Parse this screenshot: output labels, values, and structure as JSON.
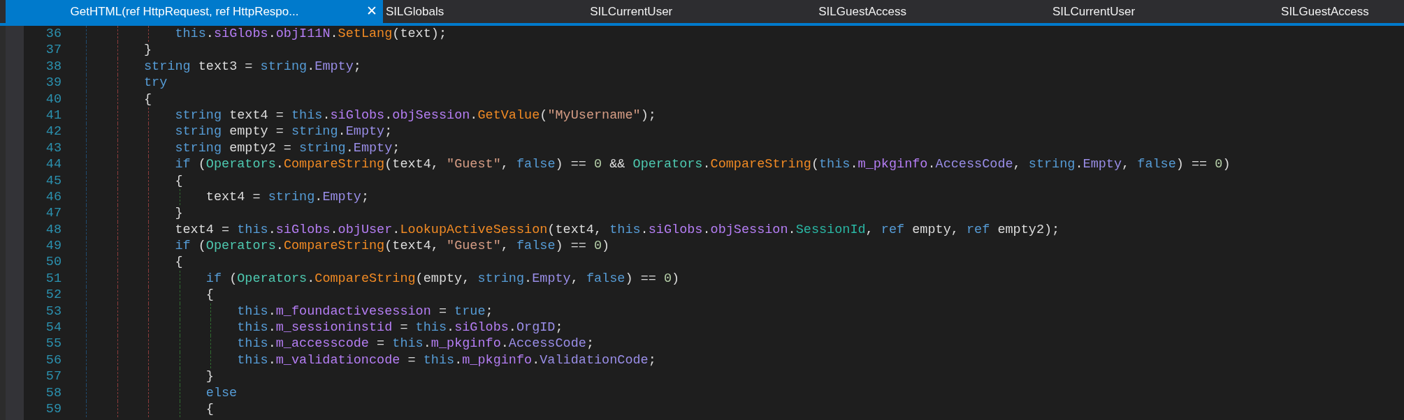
{
  "tabs": [
    {
      "label": "GetHTML(ref HttpRequest, ref HttpRespo...",
      "selected": true,
      "close": "✕"
    },
    {
      "label": "SILGlobals",
      "selected": false
    },
    {
      "label": "SILCurrentUser",
      "selected": false
    },
    {
      "label": "SILGuestAccess",
      "selected": false
    },
    {
      "label": "SILCurrentUser",
      "selected": false
    },
    {
      "label": "SILGuestAccess",
      "selected": false
    }
  ],
  "code": {
    "lines": [
      {
        "number": "36",
        "tokens": [
          {
            "kind": "keyword",
            "text": "    this"
          },
          {
            "kind": "plain",
            "text": "."
          },
          {
            "kind": "field",
            "text": "siGlobs"
          },
          {
            "kind": "plain",
            "text": "."
          },
          {
            "kind": "field",
            "text": "objI11N"
          },
          {
            "kind": "plain",
            "text": "."
          },
          {
            "kind": "method",
            "text": "SetLang"
          },
          {
            "kind": "plain",
            "text": "(text);"
          }
        ]
      },
      {
        "number": "37",
        "tokens": [
          {
            "kind": "plain",
            "text": "}"
          }
        ]
      },
      {
        "number": "38",
        "tokens": [
          {
            "kind": "keyword",
            "text": "string"
          },
          {
            "kind": "plain",
            "text": " text3 = "
          },
          {
            "kind": "keyword",
            "text": "string"
          },
          {
            "kind": "plain",
            "text": "."
          },
          {
            "kind": "member",
            "text": "Empty"
          },
          {
            "kind": "plain",
            "text": ";"
          }
        ]
      },
      {
        "number": "39",
        "tokens": [
          {
            "kind": "keyword",
            "text": "try"
          }
        ]
      },
      {
        "number": "40",
        "tokens": [
          {
            "kind": "plain",
            "text": "{"
          }
        ]
      },
      {
        "number": "41",
        "tokens": [
          {
            "kind": "keyword",
            "text": "    string"
          },
          {
            "kind": "plain",
            "text": " text4 = "
          },
          {
            "kind": "keyword",
            "text": "this"
          },
          {
            "kind": "plain",
            "text": "."
          },
          {
            "kind": "field",
            "text": "siGlobs"
          },
          {
            "kind": "plain",
            "text": "."
          },
          {
            "kind": "field",
            "text": "objSession"
          },
          {
            "kind": "plain",
            "text": "."
          },
          {
            "kind": "method",
            "text": "GetValue"
          },
          {
            "kind": "plain",
            "text": "("
          },
          {
            "kind": "string",
            "text": "\"MyUsername\""
          },
          {
            "kind": "plain",
            "text": ");"
          }
        ]
      },
      {
        "number": "42",
        "tokens": [
          {
            "kind": "keyword",
            "text": "    string"
          },
          {
            "kind": "plain",
            "text": " empty = "
          },
          {
            "kind": "keyword",
            "text": "string"
          },
          {
            "kind": "plain",
            "text": "."
          },
          {
            "kind": "member",
            "text": "Empty"
          },
          {
            "kind": "plain",
            "text": ";"
          }
        ]
      },
      {
        "number": "43",
        "tokens": [
          {
            "kind": "keyword",
            "text": "    string"
          },
          {
            "kind": "plain",
            "text": " empty2 = "
          },
          {
            "kind": "keyword",
            "text": "string"
          },
          {
            "kind": "plain",
            "text": "."
          },
          {
            "kind": "member",
            "text": "Empty"
          },
          {
            "kind": "plain",
            "text": ";"
          }
        ]
      },
      {
        "number": "44",
        "tokens": [
          {
            "kind": "keyword",
            "text": "    if"
          },
          {
            "kind": "plain",
            "text": " ("
          },
          {
            "kind": "type",
            "text": "Operators"
          },
          {
            "kind": "plain",
            "text": "."
          },
          {
            "kind": "method",
            "text": "CompareString"
          },
          {
            "kind": "plain",
            "text": "(text4, "
          },
          {
            "kind": "string",
            "text": "\"Guest\""
          },
          {
            "kind": "plain",
            "text": ", "
          },
          {
            "kind": "keyword",
            "text": "false"
          },
          {
            "kind": "plain",
            "text": ") == "
          },
          {
            "kind": "number",
            "text": "0"
          },
          {
            "kind": "plain",
            "text": " && "
          },
          {
            "kind": "type",
            "text": "Operators"
          },
          {
            "kind": "plain",
            "text": "."
          },
          {
            "kind": "method",
            "text": "CompareString"
          },
          {
            "kind": "plain",
            "text": "("
          },
          {
            "kind": "keyword",
            "text": "this"
          },
          {
            "kind": "plain",
            "text": "."
          },
          {
            "kind": "field",
            "text": "m_pkginfo"
          },
          {
            "kind": "plain",
            "text": "."
          },
          {
            "kind": "member",
            "text": "AccessCode"
          },
          {
            "kind": "plain",
            "text": ", "
          },
          {
            "kind": "keyword",
            "text": "string"
          },
          {
            "kind": "plain",
            "text": "."
          },
          {
            "kind": "member",
            "text": "Empty"
          },
          {
            "kind": "plain",
            "text": ", "
          },
          {
            "kind": "keyword",
            "text": "false"
          },
          {
            "kind": "plain",
            "text": ") == "
          },
          {
            "kind": "number",
            "text": "0"
          },
          {
            "kind": "plain",
            "text": ")"
          }
        ]
      },
      {
        "number": "45",
        "tokens": [
          {
            "kind": "plain",
            "text": "    {"
          }
        ]
      },
      {
        "number": "46",
        "tokens": [
          {
            "kind": "plain",
            "text": "        text4 = "
          },
          {
            "kind": "keyword",
            "text": "string"
          },
          {
            "kind": "plain",
            "text": "."
          },
          {
            "kind": "member",
            "text": "Empty"
          },
          {
            "kind": "plain",
            "text": ";"
          }
        ]
      },
      {
        "number": "47",
        "tokens": [
          {
            "kind": "plain",
            "text": "    }"
          }
        ]
      },
      {
        "number": "48",
        "tokens": [
          {
            "kind": "plain",
            "text": "    text4 = "
          },
          {
            "kind": "keyword",
            "text": "this"
          },
          {
            "kind": "plain",
            "text": "."
          },
          {
            "kind": "field",
            "text": "siGlobs"
          },
          {
            "kind": "plain",
            "text": "."
          },
          {
            "kind": "field",
            "text": "objUser"
          },
          {
            "kind": "plain",
            "text": "."
          },
          {
            "kind": "method",
            "text": "LookupActiveSession"
          },
          {
            "kind": "plain",
            "text": "(text4, "
          },
          {
            "kind": "keyword",
            "text": "this"
          },
          {
            "kind": "plain",
            "text": "."
          },
          {
            "kind": "field",
            "text": "siGlobs"
          },
          {
            "kind": "plain",
            "text": "."
          },
          {
            "kind": "field",
            "text": "objSession"
          },
          {
            "kind": "plain",
            "text": "."
          },
          {
            "kind": "property",
            "text": "SessionId"
          },
          {
            "kind": "plain",
            "text": ", "
          },
          {
            "kind": "keyword",
            "text": "ref"
          },
          {
            "kind": "plain",
            "text": " empty, "
          },
          {
            "kind": "keyword",
            "text": "ref"
          },
          {
            "kind": "plain",
            "text": " empty2);"
          }
        ]
      },
      {
        "number": "49",
        "tokens": [
          {
            "kind": "keyword",
            "text": "    if"
          },
          {
            "kind": "plain",
            "text": " ("
          },
          {
            "kind": "type",
            "text": "Operators"
          },
          {
            "kind": "plain",
            "text": "."
          },
          {
            "kind": "method",
            "text": "CompareString"
          },
          {
            "kind": "plain",
            "text": "(text4, "
          },
          {
            "kind": "string",
            "text": "\"Guest\""
          },
          {
            "kind": "plain",
            "text": ", "
          },
          {
            "kind": "keyword",
            "text": "false"
          },
          {
            "kind": "plain",
            "text": ") == "
          },
          {
            "kind": "number",
            "text": "0"
          },
          {
            "kind": "plain",
            "text": ")"
          }
        ]
      },
      {
        "number": "50",
        "tokens": [
          {
            "kind": "plain",
            "text": "    {"
          }
        ]
      },
      {
        "number": "51",
        "tokens": [
          {
            "kind": "keyword",
            "text": "        if"
          },
          {
            "kind": "plain",
            "text": " ("
          },
          {
            "kind": "type",
            "text": "Operators"
          },
          {
            "kind": "plain",
            "text": "."
          },
          {
            "kind": "method",
            "text": "CompareString"
          },
          {
            "kind": "plain",
            "text": "(empty, "
          },
          {
            "kind": "keyword",
            "text": "string"
          },
          {
            "kind": "plain",
            "text": "."
          },
          {
            "kind": "member",
            "text": "Empty"
          },
          {
            "kind": "plain",
            "text": ", "
          },
          {
            "kind": "keyword",
            "text": "false"
          },
          {
            "kind": "plain",
            "text": ") == "
          },
          {
            "kind": "number",
            "text": "0"
          },
          {
            "kind": "plain",
            "text": ")"
          }
        ]
      },
      {
        "number": "52",
        "tokens": [
          {
            "kind": "plain",
            "text": "        {"
          }
        ]
      },
      {
        "number": "53",
        "tokens": [
          {
            "kind": "keyword",
            "text": "            this"
          },
          {
            "kind": "plain",
            "text": "."
          },
          {
            "kind": "field",
            "text": "m_foundactivesession"
          },
          {
            "kind": "plain",
            "text": " = "
          },
          {
            "kind": "keyword",
            "text": "true"
          },
          {
            "kind": "plain",
            "text": ";"
          }
        ]
      },
      {
        "number": "54",
        "tokens": [
          {
            "kind": "keyword",
            "text": "            this"
          },
          {
            "kind": "plain",
            "text": "."
          },
          {
            "kind": "field",
            "text": "m_sessioninstid"
          },
          {
            "kind": "plain",
            "text": " = "
          },
          {
            "kind": "keyword",
            "text": "this"
          },
          {
            "kind": "plain",
            "text": "."
          },
          {
            "kind": "field",
            "text": "siGlobs"
          },
          {
            "kind": "plain",
            "text": "."
          },
          {
            "kind": "member",
            "text": "OrgID"
          },
          {
            "kind": "plain",
            "text": ";"
          }
        ]
      },
      {
        "number": "55",
        "tokens": [
          {
            "kind": "keyword",
            "text": "            this"
          },
          {
            "kind": "plain",
            "text": "."
          },
          {
            "kind": "field",
            "text": "m_accesscode"
          },
          {
            "kind": "plain",
            "text": " = "
          },
          {
            "kind": "keyword",
            "text": "this"
          },
          {
            "kind": "plain",
            "text": "."
          },
          {
            "kind": "field",
            "text": "m_pkginfo"
          },
          {
            "kind": "plain",
            "text": "."
          },
          {
            "kind": "member",
            "text": "AccessCode"
          },
          {
            "kind": "plain",
            "text": ";"
          }
        ]
      },
      {
        "number": "56",
        "tokens": [
          {
            "kind": "keyword",
            "text": "            this"
          },
          {
            "kind": "plain",
            "text": "."
          },
          {
            "kind": "field",
            "text": "m_validationcode"
          },
          {
            "kind": "plain",
            "text": " = "
          },
          {
            "kind": "keyword",
            "text": "this"
          },
          {
            "kind": "plain",
            "text": "."
          },
          {
            "kind": "field",
            "text": "m_pkginfo"
          },
          {
            "kind": "plain",
            "text": "."
          },
          {
            "kind": "member",
            "text": "ValidationCode"
          },
          {
            "kind": "plain",
            "text": ";"
          }
        ]
      },
      {
        "number": "57",
        "tokens": [
          {
            "kind": "plain",
            "text": "        }"
          }
        ]
      },
      {
        "number": "58",
        "tokens": [
          {
            "kind": "keyword",
            "text": "        else"
          }
        ]
      },
      {
        "number": "59",
        "tokens": [
          {
            "kind": "plain",
            "text": "        {"
          }
        ]
      }
    ]
  }
}
